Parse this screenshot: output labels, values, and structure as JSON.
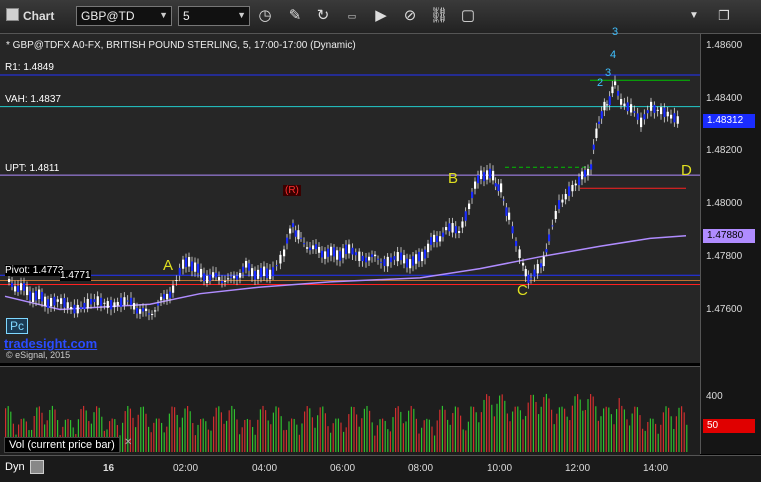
{
  "toolbar": {
    "app_title": "Chart",
    "symbol": "GBP@TD",
    "interval": "5",
    "icons": [
      "clock-icon",
      "pencil-icon",
      "cursor-refresh-icon",
      "gif-icon",
      "play-icon",
      "cancel-icon",
      "link-icon",
      "chat-icon",
      "dropdown-icon",
      "window-icon"
    ]
  },
  "chart": {
    "header": "* GBP@TDFX A0-FX, BRITISH POUND STERLING, 5, 17:00-17:00 (Dynamic)",
    "levels": {
      "r1": "R1: 1.4849",
      "vah": "VAH: 1.4837",
      "upt": "UPT: 1.4811",
      "pivot": "Pivot: 1.4773",
      "pivot_sub": "1.4771"
    },
    "letters": [
      "A",
      "B",
      "C",
      "D"
    ],
    "rev_marker": "(R)",
    "pc_label": "Pc",
    "watermark": "tradesight.com",
    "copyright": "© eSignal, 2015",
    "y_ticks": [
      "1.48600",
      "1.48400",
      "1.48200",
      "1.48000",
      "1.47800",
      "1.47600"
    ],
    "last_price": "1.48312",
    "ma_price": "1.47880",
    "top_numbers": [
      "3",
      "4",
      "3",
      "2"
    ]
  },
  "volume": {
    "label": "Vol (current price bar)",
    "ticks": [
      "400"
    ],
    "current": "50"
  },
  "bottom": {
    "dyn_label": "Dyn",
    "x_ticks": [
      "16",
      "02:00",
      "04:00",
      "06:00",
      "08:00",
      "10:00",
      "12:00",
      "14:00"
    ]
  },
  "colors": {
    "bull_candle": "#ffffff",
    "bear_candle": "#1a2cff",
    "r1_line": "#2233ff",
    "vah_line": "#22cccc",
    "upt_line": "#b08cff",
    "ma_line": "#b08cff",
    "green_line": "#00c000",
    "red_line": "#ff2020",
    "letters": "#e0e020"
  }
}
